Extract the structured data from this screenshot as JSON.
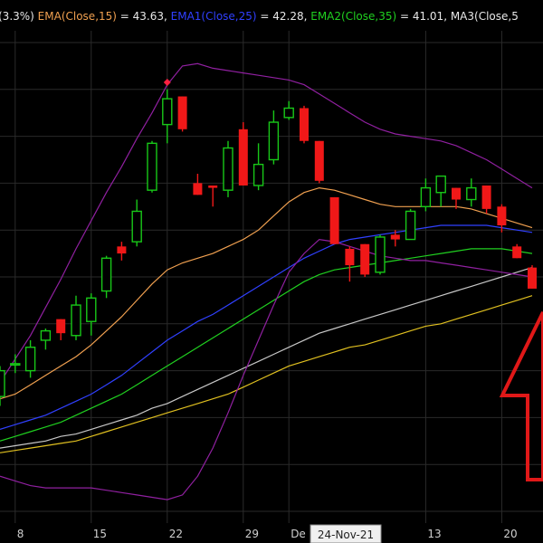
{
  "legend": [
    {
      "text": "(3.3%)",
      "color": "#e8e8e8"
    },
    {
      "text": "EMA(Close,15)",
      "color": "#f0a050"
    },
    {
      "text": " = 43.63,",
      "color": "#e8e8e8"
    },
    {
      "text": "EMA1(Close,25)",
      "color": "#3040ff"
    },
    {
      "text": " = 42.28,",
      "color": "#e8e8e8"
    },
    {
      "text": "EMA2(Close,35)",
      "color": "#20d020"
    },
    {
      "text": " = 41.01,",
      "color": "#e8e8e8"
    },
    {
      "text": "MA3(Close,5",
      "color": "#e8e8e8"
    }
  ],
  "colors": {
    "background": "#000000",
    "grid": "#2a2a2a",
    "up": "#18c818",
    "down": "#f01818",
    "arrow": "#e01818",
    "cursor_box": "#f0f0f0"
  },
  "x_ticks": [
    "8",
    "15",
    "22",
    "29",
    "De",
    "13",
    "20"
  ],
  "cursor_date": "24-Nov-21",
  "chart_data": {
    "type": "candlestick",
    "grid": true,
    "ylim": [
      29.5,
      50.5
    ],
    "x_tick_index": [
      1,
      6,
      11,
      16,
      19,
      28,
      33
    ],
    "candles": [
      {
        "o": 34.9,
        "h": 36.2,
        "l": 34.5,
        "c": 36.0
      },
      {
        "o": 36.3,
        "h": 36.7,
        "l": 35.9,
        "c": 36.3
      },
      {
        "o": 36.0,
        "h": 37.3,
        "l": 35.7,
        "c": 37.0
      },
      {
        "o": 37.3,
        "h": 37.8,
        "l": 36.9,
        "c": 37.7
      },
      {
        "o": 38.2,
        "h": 38.2,
        "l": 37.3,
        "c": 37.6
      },
      {
        "o": 37.5,
        "h": 39.2,
        "l": 37.3,
        "c": 38.8
      },
      {
        "o": 38.1,
        "h": 39.3,
        "l": 37.5,
        "c": 39.1
      },
      {
        "o": 39.4,
        "h": 40.9,
        "l": 39.1,
        "c": 40.8
      },
      {
        "o": 41.3,
        "h": 41.5,
        "l": 40.7,
        "c": 41.0
      },
      {
        "o": 41.5,
        "h": 43.3,
        "l": 41.3,
        "c": 42.8
      },
      {
        "o": 43.7,
        "h": 45.8,
        "l": 43.6,
        "c": 45.7
      },
      {
        "o": 46.5,
        "h": 48.0,
        "l": 45.7,
        "c": 47.6
      },
      {
        "o": 47.7,
        "h": 47.7,
        "l": 46.2,
        "c": 46.3
      },
      {
        "o": 44.0,
        "h": 44.4,
        "l": 43.5,
        "c": 43.5
      },
      {
        "o": 43.9,
        "h": 43.9,
        "l": 43.0,
        "c": 43.8
      },
      {
        "o": 43.7,
        "h": 45.8,
        "l": 43.4,
        "c": 45.5
      },
      {
        "o": 46.3,
        "h": 46.6,
        "l": 43.9,
        "c": 43.9
      },
      {
        "o": 43.9,
        "h": 45.7,
        "l": 43.7,
        "c": 44.8
      },
      {
        "o": 45.0,
        "h": 47.1,
        "l": 44.8,
        "c": 46.6
      },
      {
        "o": 46.8,
        "h": 47.5,
        "l": 46.7,
        "c": 47.2
      },
      {
        "o": 47.2,
        "h": 47.3,
        "l": 45.7,
        "c": 45.8
      },
      {
        "o": 45.8,
        "h": 45.8,
        "l": 44.0,
        "c": 44.1
      },
      {
        "o": 43.4,
        "h": 43.4,
        "l": 41.4,
        "c": 41.4
      },
      {
        "o": 41.2,
        "h": 41.3,
        "l": 39.8,
        "c": 40.5
      },
      {
        "o": 41.4,
        "h": 41.4,
        "l": 40.0,
        "c": 40.1
      },
      {
        "o": 40.2,
        "h": 41.8,
        "l": 40.1,
        "c": 41.7
      },
      {
        "o": 41.8,
        "h": 42.0,
        "l": 41.3,
        "c": 41.6
      },
      {
        "o": 41.6,
        "h": 42.9,
        "l": 41.6,
        "c": 42.8
      },
      {
        "o": 43.0,
        "h": 44.2,
        "l": 42.8,
        "c": 43.8
      },
      {
        "o": 43.6,
        "h": 44.3,
        "l": 43.0,
        "c": 44.3
      },
      {
        "o": 43.8,
        "h": 43.8,
        "l": 42.9,
        "c": 43.3
      },
      {
        "o": 43.3,
        "h": 44.2,
        "l": 43.0,
        "c": 43.8
      },
      {
        "o": 43.9,
        "h": 43.9,
        "l": 42.7,
        "c": 42.9
      },
      {
        "o": 43.0,
        "h": 43.1,
        "l": 41.9,
        "c": 42.2
      },
      {
        "o": 41.3,
        "h": 41.4,
        "l": 40.8,
        "c": 40.8
      },
      {
        "o": 40.4,
        "h": 40.5,
        "l": 39.5,
        "c": 39.5
      }
    ],
    "marker": {
      "index": 11,
      "value": 48.3,
      "color": "#ff2040"
    },
    "lines": [
      {
        "name": "EMA(Close,15)",
        "color": "#f0a050",
        "values": [
          34.8,
          35.0,
          35.4,
          35.8,
          36.2,
          36.6,
          37.1,
          37.7,
          38.3,
          39.0,
          39.7,
          40.3,
          40.6,
          40.8,
          41.0,
          41.3,
          41.6,
          42.0,
          42.6,
          43.2,
          43.6,
          43.8,
          43.7,
          43.5,
          43.3,
          43.1,
          43.0,
          43.0,
          43.0,
          43.0,
          43.0,
          42.9,
          42.7,
          42.5,
          42.3,
          42.1
        ]
      },
      {
        "name": "EMA1(Close,25)",
        "color": "#3040ff",
        "values": [
          33.5,
          33.7,
          33.9,
          34.1,
          34.4,
          34.7,
          35.0,
          35.4,
          35.8,
          36.3,
          36.8,
          37.3,
          37.7,
          38.1,
          38.4,
          38.8,
          39.2,
          39.6,
          40.0,
          40.4,
          40.8,
          41.1,
          41.4,
          41.6,
          41.7,
          41.8,
          41.9,
          42.0,
          42.1,
          42.2,
          42.2,
          42.2,
          42.2,
          42.1,
          42.0,
          41.9
        ]
      },
      {
        "name": "EMA2(Close,35)",
        "color": "#20d020",
        "values": [
          33.0,
          33.2,
          33.4,
          33.6,
          33.8,
          34.1,
          34.4,
          34.7,
          35.0,
          35.4,
          35.8,
          36.2,
          36.6,
          37.0,
          37.4,
          37.8,
          38.2,
          38.6,
          39.0,
          39.4,
          39.8,
          40.1,
          40.3,
          40.4,
          40.5,
          40.6,
          40.7,
          40.8,
          40.9,
          41.0,
          41.1,
          41.2,
          41.2,
          41.2,
          41.1,
          41.0
        ]
      },
      {
        "name": "MA3(Close,5",
        "color": "#c8c8c8",
        "values": [
          32.7,
          32.8,
          32.9,
          33.0,
          33.2,
          33.3,
          33.5,
          33.7,
          33.9,
          34.1,
          34.4,
          34.6,
          34.9,
          35.2,
          35.5,
          35.8,
          36.1,
          36.4,
          36.7,
          37.0,
          37.3,
          37.6,
          37.8,
          38.0,
          38.2,
          38.4,
          38.6,
          38.8,
          39.0,
          39.2,
          39.4,
          39.6,
          39.8,
          40.0,
          40.2,
          40.4
        ]
      },
      {
        "name": "",
        "color": "#e0c020",
        "values": [
          32.5,
          32.6,
          32.7,
          32.8,
          32.9,
          33.0,
          33.2,
          33.4,
          33.6,
          33.8,
          34.0,
          34.2,
          34.4,
          34.6,
          34.8,
          35.0,
          35.3,
          35.6,
          35.9,
          36.2,
          36.4,
          36.6,
          36.8,
          37.0,
          37.1,
          37.3,
          37.5,
          37.7,
          37.9,
          38.0,
          38.2,
          38.4,
          38.6,
          38.8,
          39.0,
          39.2
        ]
      },
      {
        "name": "",
        "color": "#9020a0",
        "values": [
          35.5,
          36.5,
          37.5,
          38.7,
          39.9,
          41.2,
          42.4,
          43.6,
          44.7,
          45.9,
          47.0,
          48.2,
          49.0,
          49.1,
          48.9,
          48.8,
          48.7,
          48.6,
          48.5,
          48.4,
          48.2,
          47.8,
          47.4,
          47.0,
          46.6,
          46.3,
          46.1,
          46.0,
          45.9,
          45.8,
          45.6,
          45.3,
          45.0,
          44.6,
          44.2,
          43.8
        ]
      },
      {
        "name": "",
        "color": "#9020a0",
        "values": [
          31.5,
          31.3,
          31.1,
          31.0,
          31.0,
          31.0,
          31.0,
          30.9,
          30.8,
          30.7,
          30.6,
          30.5,
          30.7,
          31.5,
          32.7,
          34.2,
          35.8,
          37.3,
          38.8,
          40.2,
          41.0,
          41.6,
          41.5,
          41.3,
          41.1,
          40.9,
          40.8,
          40.7,
          40.7,
          40.6,
          40.5,
          40.4,
          40.3,
          40.2,
          40.1,
          40.0
        ]
      }
    ]
  }
}
